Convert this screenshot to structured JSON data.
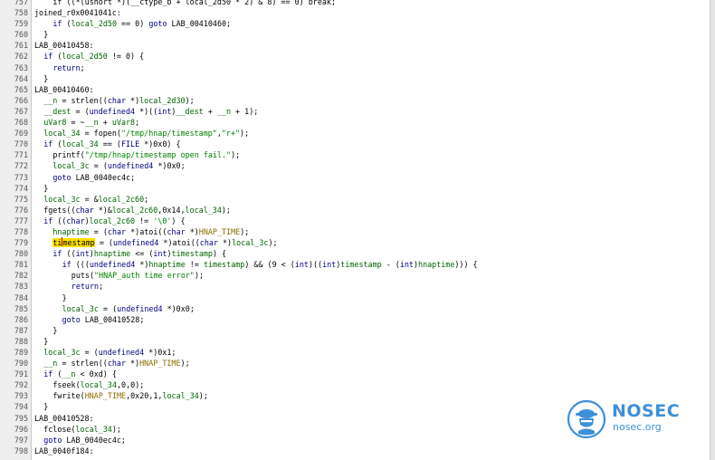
{
  "editor": {
    "lines": [
      {
        "n": "757",
        "indent": 2,
        "tokens": [
          [
            "",
            "if ((*(ushort *)(__ctype_b + local_2d50 * 2) & 8) == 0) break;"
          ]
        ]
      },
      {
        "n": "758",
        "indent": 0,
        "tokens": [
          [
            "",
            "joined_r0x0041041c:"
          ]
        ]
      },
      {
        "n": "759",
        "indent": 2,
        "tokens": [
          [
            "kw",
            "if"
          ],
          [
            "",
            " ("
          ],
          [
            "param",
            "local_2d50"
          ],
          [
            "",
            " == "
          ],
          [
            "num",
            "0"
          ],
          [
            "",
            ") "
          ],
          [
            "kw",
            "goto"
          ],
          [
            "",
            " LAB_00410460;"
          ]
        ]
      },
      {
        "n": "760",
        "indent": 1,
        "tokens": [
          [
            "",
            "}"
          ]
        ]
      },
      {
        "n": "761",
        "indent": 0,
        "tokens": [
          [
            "",
            "LAB_00410458:"
          ]
        ]
      },
      {
        "n": "762",
        "indent": 1,
        "tokens": [
          [
            "kw",
            "if"
          ],
          [
            "",
            " ("
          ],
          [
            "param",
            "local_2d50"
          ],
          [
            "",
            " != "
          ],
          [
            "num",
            "0"
          ],
          [
            "",
            ") {"
          ]
        ]
      },
      {
        "n": "763",
        "indent": 2,
        "tokens": [
          [
            "kw",
            "return"
          ],
          [
            "",
            ";"
          ]
        ]
      },
      {
        "n": "764",
        "indent": 1,
        "tokens": [
          [
            "",
            "}"
          ]
        ]
      },
      {
        "n": "765",
        "indent": 0,
        "tokens": [
          [
            "",
            "LAB_00410460:"
          ]
        ]
      },
      {
        "n": "766",
        "indent": 1,
        "tokens": [
          [
            "param",
            "__n"
          ],
          [
            "",
            " = "
          ],
          [
            "fn",
            "strlen"
          ],
          [
            "",
            "(("
          ],
          [
            "kw",
            "char"
          ],
          [
            "",
            " *)"
          ],
          [
            "param",
            "local_2d30"
          ],
          [
            "",
            ");"
          ]
        ]
      },
      {
        "n": "767",
        "indent": 1,
        "tokens": [
          [
            "param",
            "__dest"
          ],
          [
            "",
            " = ("
          ],
          [
            "kw",
            "undefined4"
          ],
          [
            "",
            " *)(("
          ],
          [
            "kw",
            "int"
          ],
          [
            "",
            ")"
          ],
          [
            "param",
            "__dest"
          ],
          [
            "",
            " + "
          ],
          [
            "param",
            "__n"
          ],
          [
            "",
            " + "
          ],
          [
            "num",
            "1"
          ],
          [
            "",
            ");"
          ]
        ]
      },
      {
        "n": "768",
        "indent": 1,
        "tokens": [
          [
            "param",
            "uVar8"
          ],
          [
            "",
            " = ~"
          ],
          [
            "param",
            "__n"
          ],
          [
            "",
            " + "
          ],
          [
            "param",
            "uVar8"
          ],
          [
            "",
            ";"
          ]
        ]
      },
      {
        "n": "769",
        "indent": 1,
        "tokens": [
          [
            "param",
            "local_34"
          ],
          [
            "",
            " = "
          ],
          [
            "fn",
            "fopen"
          ],
          [
            "",
            "("
          ],
          [
            "str",
            "\"/tmp/hnap/timestamp\""
          ],
          [
            "",
            ","
          ],
          [
            "str",
            "\"r+\""
          ],
          [
            "",
            ");"
          ]
        ]
      },
      {
        "n": "770",
        "indent": 1,
        "tokens": [
          [
            "kw",
            "if"
          ],
          [
            "",
            " ("
          ],
          [
            "param",
            "local_34"
          ],
          [
            "",
            " == ("
          ],
          [
            "kw",
            "FILE"
          ],
          [
            "",
            " *)"
          ],
          [
            "num",
            "0x0"
          ],
          [
            "",
            ") {"
          ]
        ]
      },
      {
        "n": "771",
        "indent": 2,
        "tokens": [
          [
            "fn",
            "printf"
          ],
          [
            "",
            "("
          ],
          [
            "str",
            "\"/tmp/hnap/timestamp open fail.\""
          ],
          [
            "",
            ");"
          ]
        ]
      },
      {
        "n": "772",
        "indent": 2,
        "tokens": [
          [
            "param",
            "local_3c"
          ],
          [
            "",
            " = ("
          ],
          [
            "kw",
            "undefined4"
          ],
          [
            "",
            " *)"
          ],
          [
            "num",
            "0x0"
          ],
          [
            "",
            ";"
          ]
        ]
      },
      {
        "n": "773",
        "indent": 2,
        "tokens": [
          [
            "kw",
            "goto"
          ],
          [
            "",
            " LAB_0040ec4c;"
          ]
        ]
      },
      {
        "n": "774",
        "indent": 1,
        "tokens": [
          [
            "",
            "}"
          ]
        ]
      },
      {
        "n": "775",
        "indent": 1,
        "tokens": [
          [
            "param",
            "local_3c"
          ],
          [
            "",
            " = &"
          ],
          [
            "param",
            "local_2c60"
          ],
          [
            "",
            ";"
          ]
        ]
      },
      {
        "n": "776",
        "indent": 1,
        "tokens": [
          [
            "fn",
            "fgets"
          ],
          [
            "",
            "(("
          ],
          [
            "kw",
            "char"
          ],
          [
            "",
            " *)&"
          ],
          [
            "param",
            "local_2c60"
          ],
          [
            "",
            ","
          ],
          [
            "num",
            "0x14"
          ],
          [
            "",
            ","
          ],
          [
            "param",
            "local_34"
          ],
          [
            "",
            ");"
          ]
        ]
      },
      {
        "n": "777",
        "indent": 1,
        "tokens": [
          [
            "kw",
            "if"
          ],
          [
            "",
            " (("
          ],
          [
            "kw",
            "char"
          ],
          [
            "",
            ")"
          ],
          [
            "param",
            "local_2c60"
          ],
          [
            "",
            " != "
          ],
          [
            "str",
            "'\\0'"
          ],
          [
            "",
            ") {"
          ]
        ]
      },
      {
        "n": "778",
        "indent": 2,
        "tokens": [
          [
            "param",
            "hnaptime"
          ],
          [
            "",
            " = ("
          ],
          [
            "kw",
            "char"
          ],
          [
            "",
            " *)"
          ],
          [
            "fn",
            "atoi"
          ],
          [
            "",
            "(("
          ],
          [
            "kw",
            "char"
          ],
          [
            "",
            " *)"
          ],
          [
            "glob",
            "HNAP_TIME"
          ],
          [
            "",
            ");"
          ]
        ]
      },
      {
        "n": "779",
        "indent": 2,
        "tokens": [
          [
            "hl",
            "ti"
          ],
          [
            "cursor",
            ""
          ],
          [
            "hl",
            "mestamp"
          ],
          [
            "",
            " = ("
          ],
          [
            "kw",
            "undefined4"
          ],
          [
            "",
            " *)"
          ],
          [
            "fn",
            "atoi"
          ],
          [
            "",
            "(("
          ],
          [
            "kw",
            "char"
          ],
          [
            "",
            " *)"
          ],
          [
            "param",
            "local_3c"
          ],
          [
            "",
            ");"
          ]
        ]
      },
      {
        "n": "780",
        "indent": 2,
        "tokens": [
          [
            "kw",
            "if"
          ],
          [
            "",
            " (("
          ],
          [
            "kw",
            "int"
          ],
          [
            "",
            ")"
          ],
          [
            "param",
            "hnaptime"
          ],
          [
            "",
            " <= ("
          ],
          [
            "kw",
            "int"
          ],
          [
            "",
            ")"
          ],
          [
            "param",
            "timestamp"
          ],
          [
            "",
            ") {"
          ]
        ]
      },
      {
        "n": "781",
        "indent": 3,
        "tokens": [
          [
            "kw",
            "if"
          ],
          [
            "",
            " ((("
          ],
          [
            "kw",
            "undefined4"
          ],
          [
            "",
            " *)"
          ],
          [
            "param",
            "hnaptime"
          ],
          [
            "",
            " != "
          ],
          [
            "param",
            "timestamp"
          ],
          [
            "",
            ") && ("
          ],
          [
            "num",
            "9"
          ],
          [
            "",
            " < ("
          ],
          [
            "kw",
            "int"
          ],
          [
            "",
            ")(("
          ],
          [
            "kw",
            "int"
          ],
          [
            "",
            ")"
          ],
          [
            "param",
            "timestamp"
          ],
          [
            "",
            " - ("
          ],
          [
            "kw",
            "int"
          ],
          [
            "",
            ")"
          ],
          [
            "param",
            "hnaptime"
          ],
          [
            "",
            "))) {"
          ]
        ]
      },
      {
        "n": "782",
        "indent": 4,
        "tokens": [
          [
            "fn",
            "puts"
          ],
          [
            "",
            "("
          ],
          [
            "str",
            "\"HNAP_auth time error\""
          ],
          [
            "",
            ");"
          ]
        ]
      },
      {
        "n": "783",
        "indent": 4,
        "tokens": [
          [
            "kw",
            "return"
          ],
          [
            "",
            ";"
          ]
        ]
      },
      {
        "n": "784",
        "indent": 3,
        "tokens": [
          [
            "",
            "}"
          ]
        ]
      },
      {
        "n": "785",
        "indent": 3,
        "tokens": [
          [
            "param",
            "local_3c"
          ],
          [
            "",
            " = ("
          ],
          [
            "kw",
            "undefined4"
          ],
          [
            "",
            " *)"
          ],
          [
            "num",
            "0x0"
          ],
          [
            "",
            ";"
          ]
        ]
      },
      {
        "n": "786",
        "indent": 3,
        "tokens": [
          [
            "kw",
            "goto"
          ],
          [
            "",
            " LAB_00410528;"
          ]
        ]
      },
      {
        "n": "787",
        "indent": 2,
        "tokens": [
          [
            "",
            "}"
          ]
        ]
      },
      {
        "n": "788",
        "indent": 1,
        "tokens": [
          [
            "",
            "}"
          ]
        ]
      },
      {
        "n": "789",
        "indent": 1,
        "tokens": [
          [
            "param",
            "local_3c"
          ],
          [
            "",
            " = ("
          ],
          [
            "kw",
            "undefined4"
          ],
          [
            "",
            " *)"
          ],
          [
            "num",
            "0x1"
          ],
          [
            "",
            ";"
          ]
        ]
      },
      {
        "n": "790",
        "indent": 1,
        "tokens": [
          [
            "param",
            "__n"
          ],
          [
            "",
            " = "
          ],
          [
            "fn",
            "strlen"
          ],
          [
            "",
            "(("
          ],
          [
            "kw",
            "char"
          ],
          [
            "",
            " *)"
          ],
          [
            "glob",
            "HNAP_TIME"
          ],
          [
            "",
            ");"
          ]
        ]
      },
      {
        "n": "791",
        "indent": 1,
        "tokens": [
          [
            "kw",
            "if"
          ],
          [
            "",
            " ("
          ],
          [
            "param",
            "__n"
          ],
          [
            "",
            " < "
          ],
          [
            "num",
            "0xd"
          ],
          [
            "",
            ") {"
          ]
        ]
      },
      {
        "n": "792",
        "indent": 2,
        "tokens": [
          [
            "fn",
            "fseek"
          ],
          [
            "",
            "("
          ],
          [
            "param",
            "local_34"
          ],
          [
            "",
            ","
          ],
          [
            "num",
            "0"
          ],
          [
            "",
            ","
          ],
          [
            "num",
            "0"
          ],
          [
            "",
            ");"
          ]
        ]
      },
      {
        "n": "793",
        "indent": 2,
        "tokens": [
          [
            "fn",
            "fwrite"
          ],
          [
            "",
            "("
          ],
          [
            "glob",
            "HNAP_TIME"
          ],
          [
            "",
            ","
          ],
          [
            "num",
            "0x20"
          ],
          [
            "",
            ","
          ],
          [
            "num",
            "1"
          ],
          [
            "",
            ","
          ],
          [
            "param",
            "local_34"
          ],
          [
            "",
            ");"
          ]
        ]
      },
      {
        "n": "794",
        "indent": 1,
        "tokens": [
          [
            "",
            "}"
          ]
        ]
      },
      {
        "n": "795",
        "indent": 0,
        "tokens": [
          [
            "",
            "LAB_00410528:"
          ]
        ]
      },
      {
        "n": "796",
        "indent": 1,
        "tokens": [
          [
            "fn",
            "fclose"
          ],
          [
            "",
            "("
          ],
          [
            "param",
            "local_34"
          ],
          [
            "",
            ");"
          ]
        ]
      },
      {
        "n": "797",
        "indent": 1,
        "tokens": [
          [
            "kw",
            "goto"
          ],
          [
            "",
            " LAB_0040ec4c;"
          ]
        ]
      },
      {
        "n": "798",
        "indent": 0,
        "tokens": [
          [
            "",
            "LAB_0040f184:"
          ]
        ]
      }
    ]
  },
  "colors": {
    "keyword": "#000080",
    "string": "#008000",
    "variable": "#006400",
    "global": "#8a6d00",
    "highlight": "#ffe000",
    "gutter": "#eeeeee",
    "watermark": "#3d8fd8"
  },
  "watermark": {
    "icon": "nosec-shield-icon",
    "title": "NOSEC",
    "subtitle": "nosec.org"
  }
}
